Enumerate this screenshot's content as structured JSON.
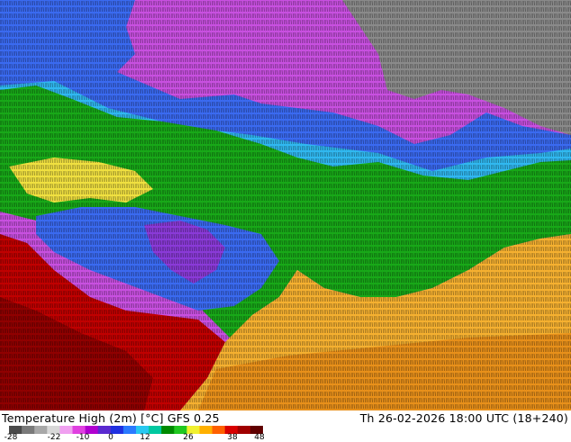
{
  "map": {
    "product": "Temperature High (2m) [°C] GFS 0.25",
    "valid_time": "Th 26-02-2026 18:00 UTC (18+240)"
  },
  "legend": {
    "ticks": [
      "-28",
      "-22",
      "-10",
      "0",
      "12",
      "26",
      "38",
      "48"
    ],
    "colors": [
      "#4a4a4a",
      "#7a7a7a",
      "#a8a8a8",
      "#d8d8d8",
      "#f0a0f0",
      "#e040e0",
      "#b000d0",
      "#5a2ad0",
      "#2030e0",
      "#2a7aff",
      "#28c8f0",
      "#00c8a0",
      "#008a00",
      "#20c820",
      "#f0f030",
      "#ffb000",
      "#ff6000",
      "#d80000",
      "#a00000",
      "#600000"
    ]
  },
  "regions": {
    "colors": {
      "grey_cold": "#8a8a8a",
      "magenta": "#c850e0",
      "purple": "#8a3ad8",
      "blue": "#3a6af0",
      "light_blue": "#30b8f0",
      "green": "#18a818",
      "yellow": "#f0e040",
      "orange": "#f5b030",
      "dark_orange": "#e8901a",
      "red": "#c00000",
      "dark_red": "#900000"
    }
  }
}
